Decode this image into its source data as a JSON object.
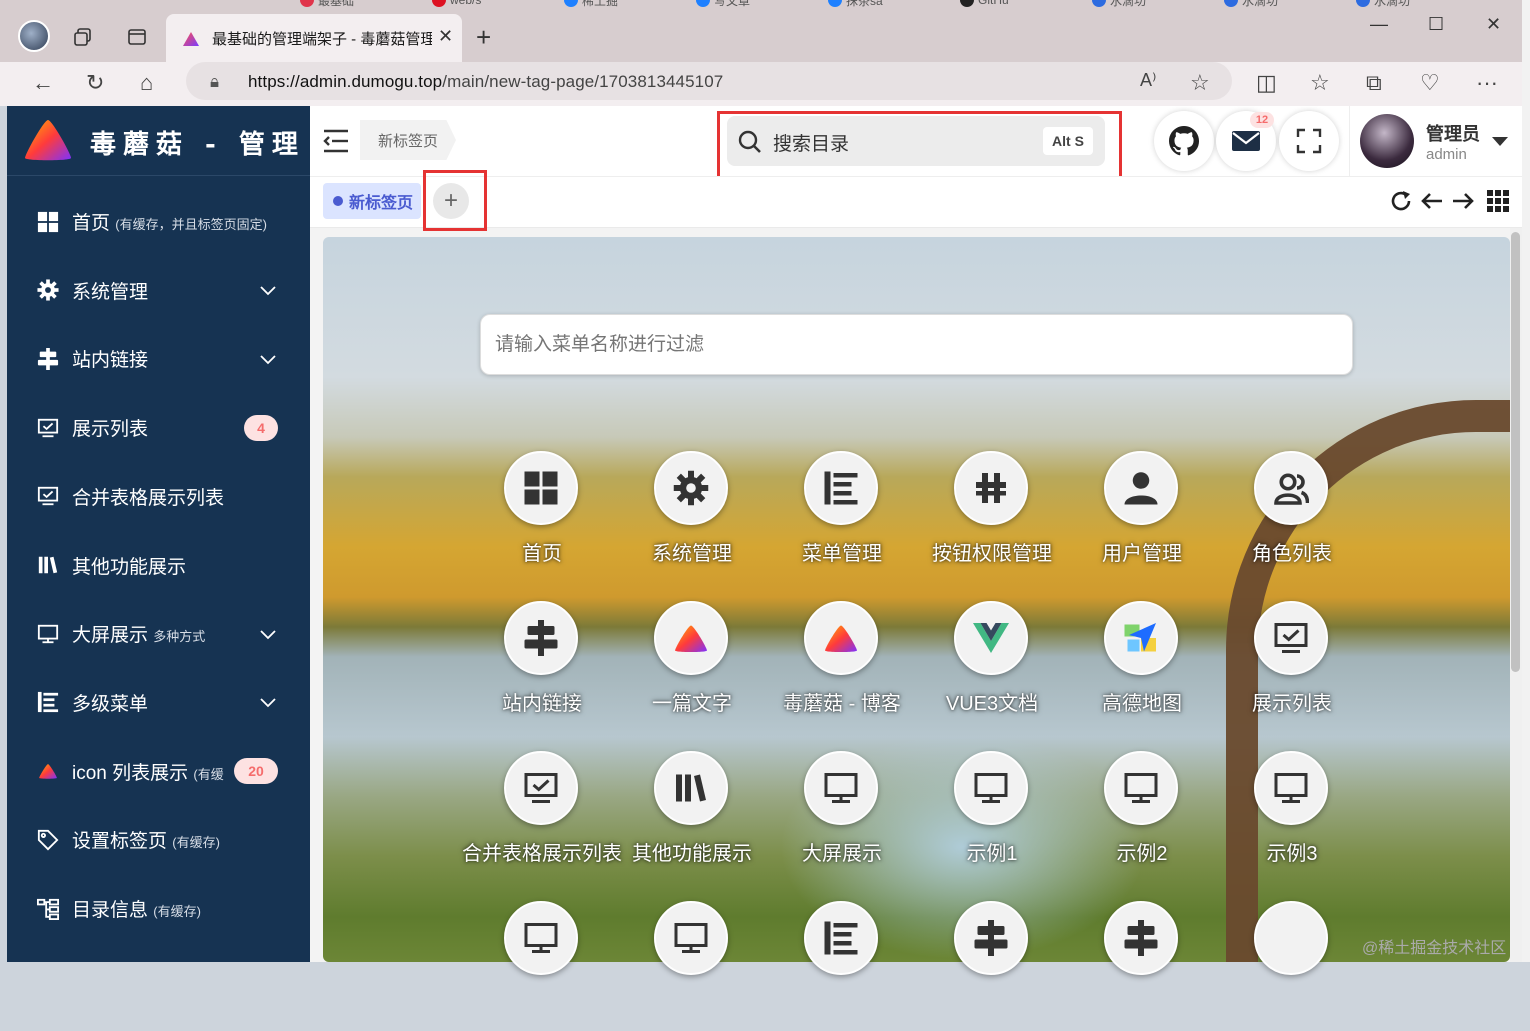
{
  "browser": {
    "active_tab_title": "最基础的管理端架子 - 毒蘑菇管理",
    "url_host": "https://admin.dumogu.top",
    "url_path": "/main/new-tag-page/1703813445107",
    "strip_tabs": [
      "最基础",
      "web/s",
      "稀土掘",
      "写文章",
      "抹茶sa",
      "GitHu",
      "水滴功",
      "水滴功",
      "水滴功"
    ]
  },
  "sidebar": {
    "logo_text": "毒蘑菇 - 管理",
    "items": [
      {
        "icon": "grid-icon",
        "label": "首页",
        "sub": "(有缓存，并且标签页固定)",
        "arrow": false,
        "badge": ""
      },
      {
        "icon": "gear-icon",
        "label": "系统管理",
        "sub": "",
        "arrow": true,
        "badge": ""
      },
      {
        "icon": "link-align-icon",
        "label": "站内链接",
        "sub": "",
        "arrow": true,
        "badge": ""
      },
      {
        "icon": "monitor-check-icon",
        "label": "展示列表",
        "sub": "",
        "arrow": false,
        "badge": "4"
      },
      {
        "icon": "monitor-check-icon",
        "label": "合并表格展示列表",
        "sub": "",
        "arrow": false,
        "badge": ""
      },
      {
        "icon": "library-icon",
        "label": "其他功能展示",
        "sub": "",
        "arrow": false,
        "badge": ""
      },
      {
        "icon": "monitor-icon",
        "label": "大屏展示",
        "sub": "多种方式",
        "arrow": true,
        "badge": ""
      },
      {
        "icon": "list-icon",
        "label": "多级菜单",
        "sub": "",
        "arrow": true,
        "badge": ""
      },
      {
        "icon": "logo-triangle-icon",
        "label": "icon 列表展示",
        "sub": "(有缓",
        "arrow": false,
        "badge": "20"
      },
      {
        "icon": "tag-icon",
        "label": "设置标签页",
        "sub": "(有缓存)",
        "arrow": false,
        "badge": ""
      },
      {
        "icon": "tree-icon",
        "label": "目录信息",
        "sub": "(有缓存)",
        "arrow": false,
        "badge": ""
      }
    ]
  },
  "header": {
    "breadcrumb": "新标签页",
    "search_label": "搜索目录",
    "search_shortcut": "Alt S",
    "mail_badge": "12",
    "user_name": "管理员",
    "user_role": "admin"
  },
  "tabs": {
    "active_label": "新标签页",
    "add_symbol": "+"
  },
  "content": {
    "filter_placeholder": "请输入菜单名称进行过滤",
    "tiles": [
      {
        "label": "首页",
        "icon": "grid-icon"
      },
      {
        "label": "系统管理",
        "icon": "gear-icon"
      },
      {
        "label": "菜单管理",
        "icon": "list-icon"
      },
      {
        "label": "按钮权限管理",
        "icon": "hashtag-icon"
      },
      {
        "label": "用户管理",
        "icon": "user-icon"
      },
      {
        "label": "角色列表",
        "icon": "users-icon"
      },
      {
        "label": "站内链接",
        "icon": "link-align-icon"
      },
      {
        "label": "一篇文字",
        "icon": "logo-triangle-icon"
      },
      {
        "label": "毒蘑菇 - 博客",
        "icon": "logo-triangle-icon"
      },
      {
        "label": "VUE3文档",
        "icon": "vue-icon"
      },
      {
        "label": "高德地图",
        "icon": "amap-icon"
      },
      {
        "label": "展示列表",
        "icon": "monitor-check-icon"
      },
      {
        "label": "合并表格展示列表",
        "icon": "monitor-check-icon"
      },
      {
        "label": "其他功能展示",
        "icon": "library-icon"
      },
      {
        "label": "大屏展示",
        "icon": "monitor-icon"
      },
      {
        "label": "示例1",
        "icon": "monitor-icon"
      },
      {
        "label": "示例2",
        "icon": "monitor-icon"
      },
      {
        "label": "示例3",
        "icon": "monitor-icon"
      },
      {
        "label": "",
        "icon": "monitor-icon"
      },
      {
        "label": "",
        "icon": "monitor-icon"
      },
      {
        "label": "",
        "icon": "list-icon"
      },
      {
        "label": "",
        "icon": "link-align-icon"
      },
      {
        "label": "",
        "icon": "link-align-icon"
      },
      {
        "label": "",
        "icon": "blank"
      }
    ]
  },
  "watermark": "@稀土掘金技术社区",
  "colors": {
    "sidebar_bg": "#163352",
    "accent": "#4a5bd0",
    "highlight_box": "#e53333",
    "badge_bg": "#fde2e2",
    "badge_text": "#f56c6c"
  }
}
